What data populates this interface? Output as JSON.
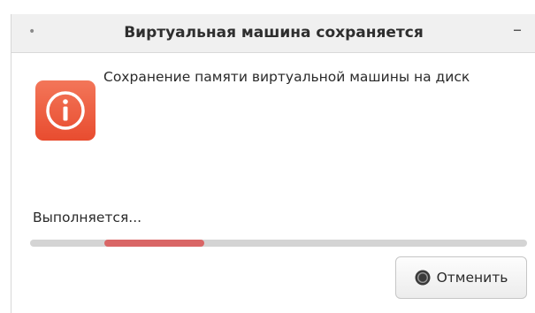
{
  "window": {
    "title": "Виртуальная машина сохраняется",
    "title_dot": "•",
    "minimize_glyph": "–"
  },
  "dialog": {
    "icon": "info-icon",
    "message": "Сохранение памяти виртуальной машины на диск",
    "status": "Выполняется...",
    "progress": {
      "start_fraction": 0.15,
      "end_fraction": 0.35
    },
    "cancel_label": "Отменить",
    "cancel_icon": "stop-icon"
  },
  "colors": {
    "icon_bg": "#ea5335",
    "progress_fill": "#d96666",
    "progress_track": "#d4d4d4"
  }
}
